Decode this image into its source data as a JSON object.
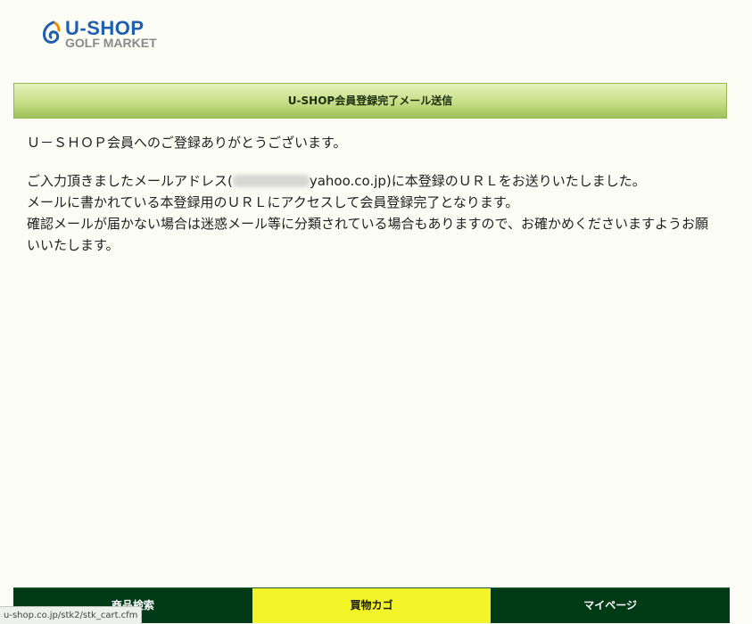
{
  "brand": {
    "name": "U-SHOP",
    "tagline": "GOLF MARKET",
    "primary_color": "#1f5fb0",
    "accent_color": "#f08a00",
    "tagline_color": "#8a8a8a"
  },
  "header": {
    "title": "U-SHOP会員登録完了メール送信"
  },
  "message": {
    "line1": "Ｕ－ＳＨＯＰ会員へのご登録ありがとうございます。",
    "line2_prefix": "ご入力頂きましたメールアドレス(",
    "email_domain": "yahoo.co.jp",
    "line2_suffix": ")に本登録のＵＲＬをお送りいたしました。",
    "line3": "メールに書かれている本登録用のＵＲＬにアクセスして会員登録完了となります。",
    "line4": "確認メールが届かない場合は迷惑メール等に分類されている場合もありますので、お確かめくださいますようお願いいたします。"
  },
  "bottom_nav": {
    "items": [
      {
        "label": "商品検索",
        "active": false
      },
      {
        "label": "買物カゴ",
        "active": true
      },
      {
        "label": "マイページ",
        "active": false
      }
    ],
    "background_color": "#003a16",
    "active_color": "#f2f427"
  },
  "status_bar": {
    "url": "u-shop.co.jp/stk2/stk_cart.cfm"
  }
}
